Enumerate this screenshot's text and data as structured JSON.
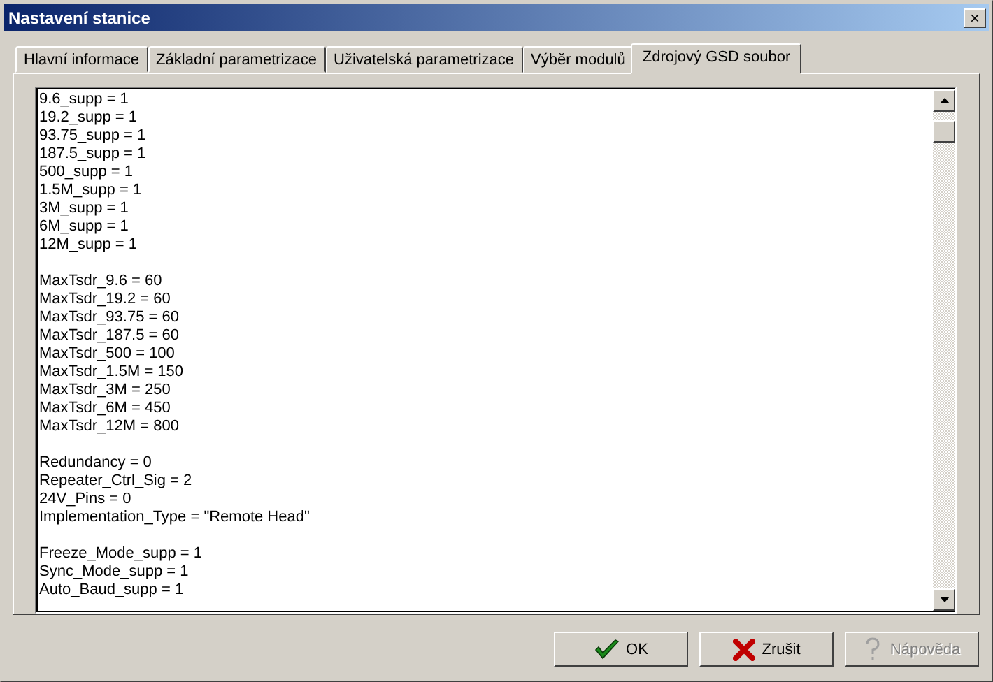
{
  "window": {
    "title": "Nastavení stanice",
    "close": "×"
  },
  "tabs": [
    {
      "label": "Hlavní informace",
      "selected": false
    },
    {
      "label": "Základní parametrizace",
      "selected": false
    },
    {
      "label": "Uživatelská parametrizace",
      "selected": false
    },
    {
      "label": "Výběr modulů",
      "selected": false
    },
    {
      "label": "Zdrojový GSD soubor",
      "selected": true
    }
  ],
  "source_text": {
    "groups": [
      [
        "9.6_supp = 1",
        "19.2_supp = 1",
        "93.75_supp = 1",
        "187.5_supp = 1",
        "500_supp = 1",
        "1.5M_supp = 1",
        "3M_supp = 1",
        "6M_supp = 1",
        "12M_supp = 1"
      ],
      [
        "MaxTsdr_9.6 = 60",
        "MaxTsdr_19.2 = 60",
        "MaxTsdr_93.75 = 60",
        "MaxTsdr_187.5 = 60",
        "MaxTsdr_500 = 100",
        "MaxTsdr_1.5M = 150",
        "MaxTsdr_3M = 250",
        "MaxTsdr_6M = 450",
        "MaxTsdr_12M = 800"
      ],
      [
        "Redundancy = 0",
        "Repeater_Ctrl_Sig = 2",
        "24V_Pins = 0",
        "Implementation_Type = \"Remote Head\""
      ],
      [
        "Freeze_Mode_supp = 1",
        "Sync_Mode_supp = 1",
        "Auto_Baud_supp = 1"
      ]
    ]
  },
  "buttons": [
    {
      "kind": "ok",
      "label": "OK",
      "disabled": false
    },
    {
      "kind": "cancel",
      "label": "Zrušit",
      "disabled": false
    },
    {
      "kind": "help",
      "label": "Nápověda",
      "disabled": true
    }
  ]
}
